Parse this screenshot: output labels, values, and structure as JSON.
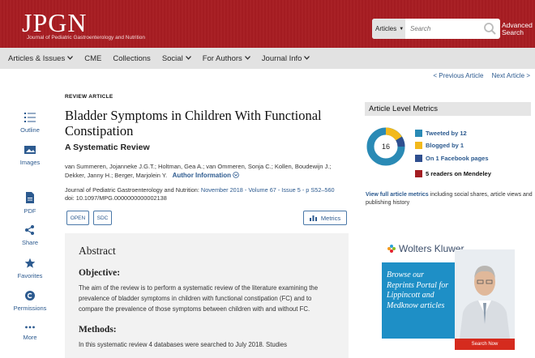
{
  "header": {
    "logo": "JPGN",
    "logo_subtitle": "Journal of Pediatric Gastroenterology and Nutrition",
    "search_scope": "Articles",
    "search_placeholder": "Search",
    "advanced_search": "Advanced Search",
    "colors": {
      "brand": "#a71d22"
    }
  },
  "nav": {
    "items": [
      {
        "label": "Articles & Issues",
        "has_dropdown": true
      },
      {
        "label": "CME",
        "has_dropdown": false
      },
      {
        "label": "Collections",
        "has_dropdown": false
      },
      {
        "label": "Social",
        "has_dropdown": true
      },
      {
        "label": "For Authors",
        "has_dropdown": true
      },
      {
        "label": "Journal Info",
        "has_dropdown": true
      }
    ]
  },
  "pager": {
    "prev": "< Previous Article",
    "next": "Next Article >"
  },
  "rail": {
    "items": [
      {
        "label": "Outline",
        "icon": "outline-icon"
      },
      {
        "label": "Images",
        "icon": "images-icon"
      },
      {
        "label": "PDF",
        "icon": "pdf-icon"
      },
      {
        "label": "Share",
        "icon": "share-icon"
      },
      {
        "label": "Favorites",
        "icon": "star-icon"
      },
      {
        "label": "Permissions",
        "icon": "copyright-icon"
      },
      {
        "label": "More",
        "icon": "ellipsis-icon"
      }
    ]
  },
  "article": {
    "type": "REVIEW ARTICLE",
    "title": "Bladder Symptoms in Children With Functional Constipation",
    "subtitle": "A Systematic Review",
    "authors": "van Summeren, Jojanneke J.G.T.; Holtman, Gea A.; van Ommeren, Sonja C.; Kollen, Boudewijn J.; Dekker, Janny H.; Berger, Marjolein Y.",
    "author_info": "Author Information",
    "journal": "Journal of Pediatric Gastroenterology and Nutrition:",
    "issue": "November 2018 - Volume 67 - Issue 5 - p S52–560",
    "doi": "doi: 10.1097/MPG.0000000000002138",
    "buttons": {
      "open": "OPEN",
      "sdc": "SDC",
      "metrics": "Metrics"
    }
  },
  "abstract": {
    "heading": "Abstract",
    "objective_heading": "Objective:",
    "objective_text": "The aim of the review is to perform a systematic review of the literature examining the prevalence of bladder symptoms in children with functional constipation (FC) and to compare the prevalence of those symptoms between children with and without FC.",
    "methods_heading": "Methods:",
    "methods_text": "In this systematic review 4 databases were searched to July 2018. Studies"
  },
  "metrics": {
    "heading": "Article Level Metrics",
    "score": "16",
    "items": [
      {
        "label": "Tweeted by 12",
        "color": "#2a8ab5",
        "style": "link"
      },
      {
        "label": "Blogged by 1",
        "color": "#f2b91c",
        "style": "link"
      },
      {
        "label": "On 1 Facebook pages",
        "color": "#2f4f8f",
        "style": "link"
      },
      {
        "label": "5 readers on Mendeley",
        "color": "#a31d22",
        "style": "dark"
      }
    ],
    "full_link": "View full article metrics",
    "full_text": " including social shares, article views and publishing history"
  },
  "ad": {
    "brand": "Wolters Kluwer",
    "text": "Browse our Reprints Portal for Lippincott and Medknow articles",
    "cta": "Search Now"
  }
}
